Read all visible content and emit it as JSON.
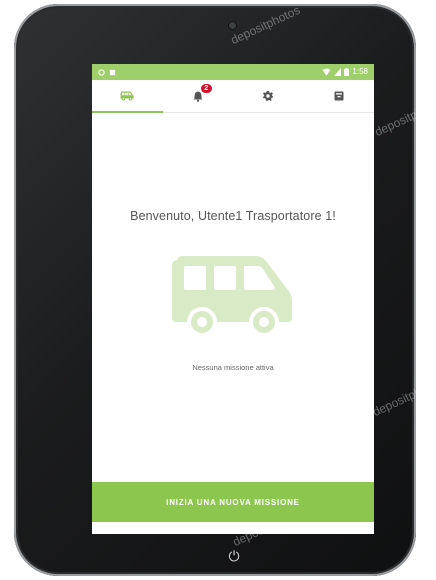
{
  "status_bar": {
    "time": "1:58",
    "color": "#9fcf6b"
  },
  "tabs": [
    {
      "name": "missions",
      "icon": "van-icon",
      "active": true
    },
    {
      "name": "notifications",
      "icon": "bell-icon",
      "badge": "2"
    },
    {
      "name": "settings",
      "icon": "gear-icon"
    },
    {
      "name": "archive",
      "icon": "archive-box-icon"
    }
  ],
  "main": {
    "welcome_text": "Benvenuto, Utente1 Trasportatore 1!",
    "empty_state_text": "Nessuna missione attiva",
    "illustration": "van-icon"
  },
  "actions": {
    "start_mission_label": "INIZIA UNA NUOVA MISSIONE"
  },
  "device": {
    "home_button": "⏻",
    "watermark_text": "depositphotos"
  },
  "colors": {
    "accent": "#8dc64e",
    "illustration": "#d9ebc6",
    "badge": "#d0112b"
  }
}
